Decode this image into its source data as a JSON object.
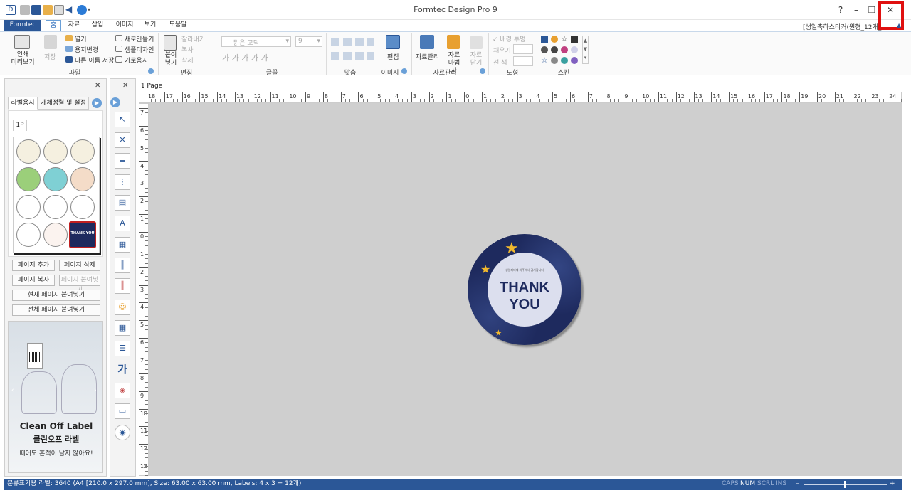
{
  "app": {
    "title": "Formtec Design Pro 9"
  },
  "window": {
    "help": "?",
    "minimize": "–",
    "restore": "❐",
    "close": "✕"
  },
  "menu_tabs": [
    {
      "label": "Formtec"
    },
    {
      "label": "홈"
    },
    {
      "label": "자료"
    },
    {
      "label": "삽입"
    },
    {
      "label": "이미지"
    },
    {
      "label": "보기"
    },
    {
      "label": "도움말"
    }
  ],
  "doc_name": "[생일축하스티커(원형_12개_",
  "ribbon": {
    "print_preview": "인쇄\n미리보기",
    "save": "저장",
    "open": "열기",
    "change_paper": "용지변경",
    "save_as": "다른 이름 저장",
    "new": "새로만들기",
    "sample_design": "샘플디자인",
    "landscape": "가로용지",
    "file_group": "파일",
    "paste": "붙여\n넣기",
    "cut": "잘라내기",
    "copy": "복사",
    "delete": "삭제",
    "edit_group": "편집",
    "font_name": "맑은 고딕",
    "font_size": "9",
    "font_styles": "가 가 가 가 가",
    "font_group": "글꼴",
    "align_group": "맞춤",
    "image_edit": "편집",
    "image_group": "이미지",
    "data_manage": "자료관리",
    "data_wizard": "자료\n마법사",
    "data_close": "자료\n닫기",
    "data_group": "자료관리",
    "bg_transparent": "배경 투명",
    "fill": "채우기",
    "line_color": "선 색",
    "shape_group": "도형",
    "skin_group": "스킨"
  },
  "left_panel": {
    "close": "✕",
    "tab_label_paper": "라벨용지",
    "tab_arrange": "개체정렬 및 설정",
    "page_tab": "1P",
    "add_page": "페이지 추가",
    "delete_page": "페이지 삭제",
    "copy_page": "페이지 복사",
    "paste_page": "페이지 붙여넣기",
    "paste_current": "현재 페이지 붙여넣기",
    "paste_all": "전체 페이지 붙여넣기",
    "ad_title": "Clean Off Label",
    "ad_title_kr": "클린오프 라벨",
    "ad_sub": "떼어도 흔적이 남지 않아요!",
    "ad_barcode": "8 76007 5",
    "thumb_thank": "THANK YOU"
  },
  "toolbox": {
    "close": "✕",
    "text_tool": "가"
  },
  "document": {
    "tab": "1 Page",
    "sticker_small": "생일파티에 와주셔서 감사합니다",
    "sticker_line1": "THANK",
    "sticker_line2": "YOU"
  },
  "ruler": {
    "top": [
      "18",
      "17",
      "16",
      "15",
      "14",
      "13",
      "12",
      "11",
      "10",
      "9",
      "8",
      "7",
      "6",
      "5",
      "4",
      "3",
      "2",
      "1",
      "0",
      "1",
      "2",
      "3",
      "4",
      "5",
      "6",
      "7",
      "8",
      "9",
      "10",
      "11",
      "12",
      "13",
      "14",
      "15",
      "16",
      "17",
      "18",
      "19",
      "20",
      "21",
      "22",
      "23",
      "24"
    ],
    "left": [
      "7",
      "6",
      "5",
      "4",
      "3",
      "2",
      "1",
      "0",
      "1",
      "2",
      "3",
      "4",
      "5",
      "6",
      "7",
      "8",
      "9",
      "10",
      "11",
      "12",
      "13"
    ]
  },
  "status": {
    "info": "분류표기용 라벨: 3640 (A4 [210.0 x 297.0 mm], Size: 63.00 x 63.00 mm,  Labels: 4 x 3 = 12개)",
    "caps": "CAPS",
    "num": "NUM",
    "scrl": "SCRL",
    "ins": "INS",
    "zoom_minus": "–",
    "zoom_plus": "+"
  },
  "colors": {
    "accent": "#2b5797",
    "sticker_navy": "#1e2a5e",
    "star": "#f1b82d",
    "highlight": "#e01010"
  }
}
